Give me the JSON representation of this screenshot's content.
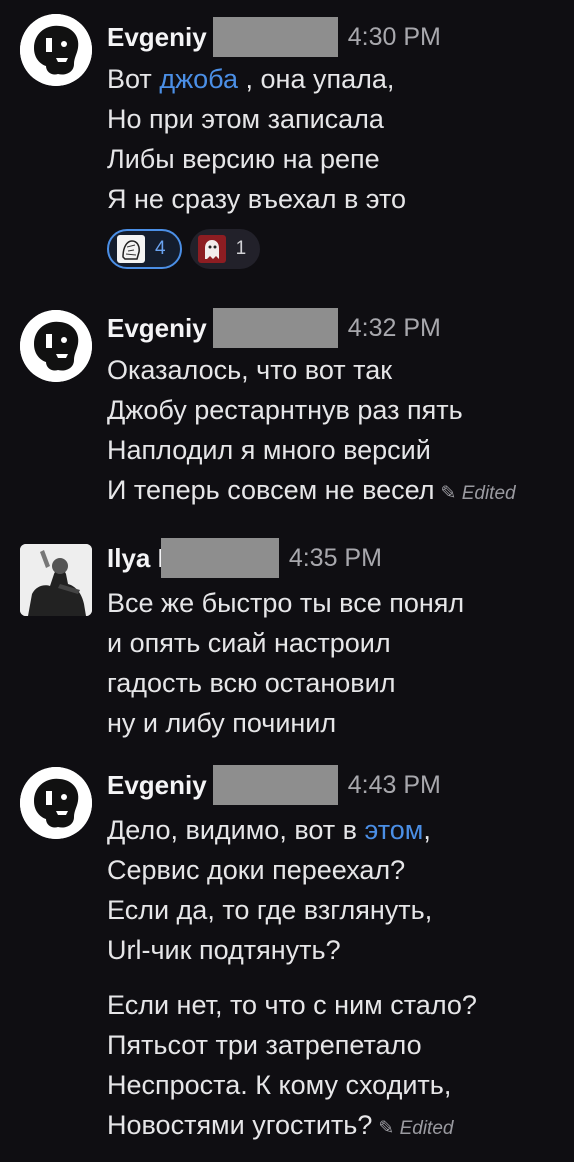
{
  "messages": [
    {
      "author": "Evgeniy",
      "time": "4:30 PM",
      "lines": [
        {
          "before": "Вот ",
          "link": "джоба",
          "after": " , она упала,"
        },
        "Но при этом записала",
        "Либы версию на репе",
        "Я не сразу въехал в это"
      ],
      "reactions": [
        {
          "emoji": "sketch-portrait-emoji",
          "count": "4",
          "active": true
        },
        {
          "emoji": "ghost-emoji",
          "count": "1",
          "active": false
        }
      ]
    },
    {
      "author": "Evgeniy",
      "time": "4:32 PM",
      "lines": [
        "Оказалось, что вот так",
        "Джобу рестарнтнув раз пять",
        "Наплодил я много версий",
        "И теперь совсем не весел"
      ],
      "edited": "Edited"
    },
    {
      "author": "Ilya I",
      "time": "4:35 PM",
      "lines": [
        "Все же быстро ты все понял",
        "и опять сиай настроил",
        "гадость всю остановил",
        "ну и либу починил"
      ]
    },
    {
      "author": "Evgeniy",
      "time": "4:43 PM",
      "lines": [
        {
          "before": "Дело, видимо, вот в ",
          "link": "этом",
          "after": ","
        },
        "Сервис доки переехал?",
        "Если да, то где взглянуть,",
        "Url-чик подтянуть?"
      ],
      "lines2": [
        "Если нет, то что с ним стало?",
        "Пятьсот три затрепетало",
        "Неспроста. К кому сходить,",
        "Новостями угостить?"
      ],
      "edited": "Edited"
    }
  ],
  "icons": {
    "edited": "pencil-icon"
  },
  "colors": {
    "background": "#0f0e12",
    "link": "#4b8fe6",
    "redaction": "#8e8e8e"
  }
}
